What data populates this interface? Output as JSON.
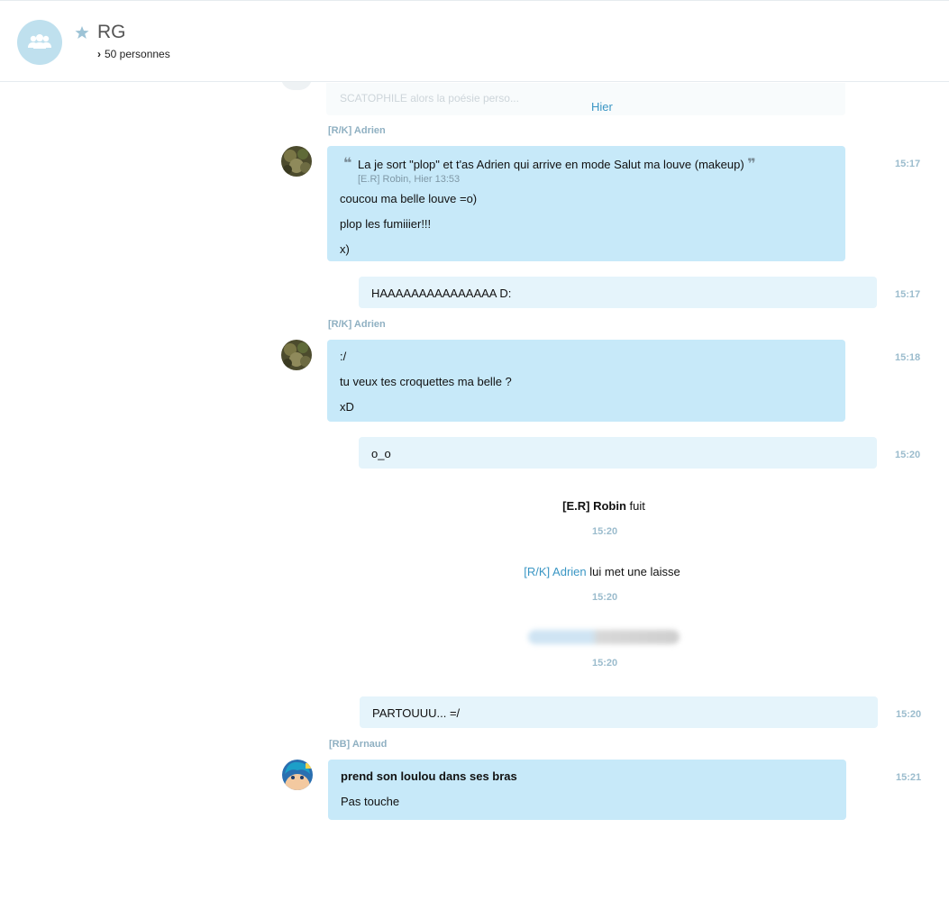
{
  "header": {
    "title": "RG",
    "members": "50 personnes"
  },
  "history": {
    "faded_text": "SCATOPHILE alors la poésie perso...",
    "day_separator": "Hier"
  },
  "messages": [
    {
      "sender": "[R/K] Adrien",
      "time": "15:17",
      "quote_text": "La je sort \"plop\" et t'as Adrien qui arrive en mode Salut ma louve (makeup)",
      "quote_meta": "[E.R] Robin, Hier 13:53",
      "lines": [
        "coucou ma belle louve =o)",
        "plop les fumiiier!!!",
        "x)"
      ]
    },
    {
      "self": true,
      "time": "15:17",
      "lines": [
        "HAAAAAAAAAAAAAAA D:"
      ]
    },
    {
      "sender": "[R/K] Adrien",
      "time": "15:18",
      "lines": [
        ":/",
        "tu veux tes croquettes ma belle ?",
        "xD"
      ]
    },
    {
      "self": true,
      "time": "15:20",
      "lines": [
        "o_o"
      ]
    },
    {
      "self": true,
      "time": "15:20",
      "lines": [
        "PARTOUUU... =/"
      ]
    },
    {
      "sender": "[RB] Arnaud",
      "time": "15:21",
      "lines": [
        "prend son loulou dans ses bras",
        "Pas touche"
      ]
    }
  ],
  "events": [
    {
      "actor_prefix": "[E.R]",
      "actor_name": "Robin",
      "action": "fuit",
      "time": "15:20"
    },
    {
      "actor": "[R/K] Adrien",
      "action": "lui met une laisse",
      "time": "15:20"
    },
    {
      "time": "15:20"
    }
  ],
  "colors": {
    "accent": "#3a96c4",
    "bubble_other": "#c7e9f9",
    "bubble_self": "#e5f4fb",
    "timestamp": "#9bbccd"
  }
}
